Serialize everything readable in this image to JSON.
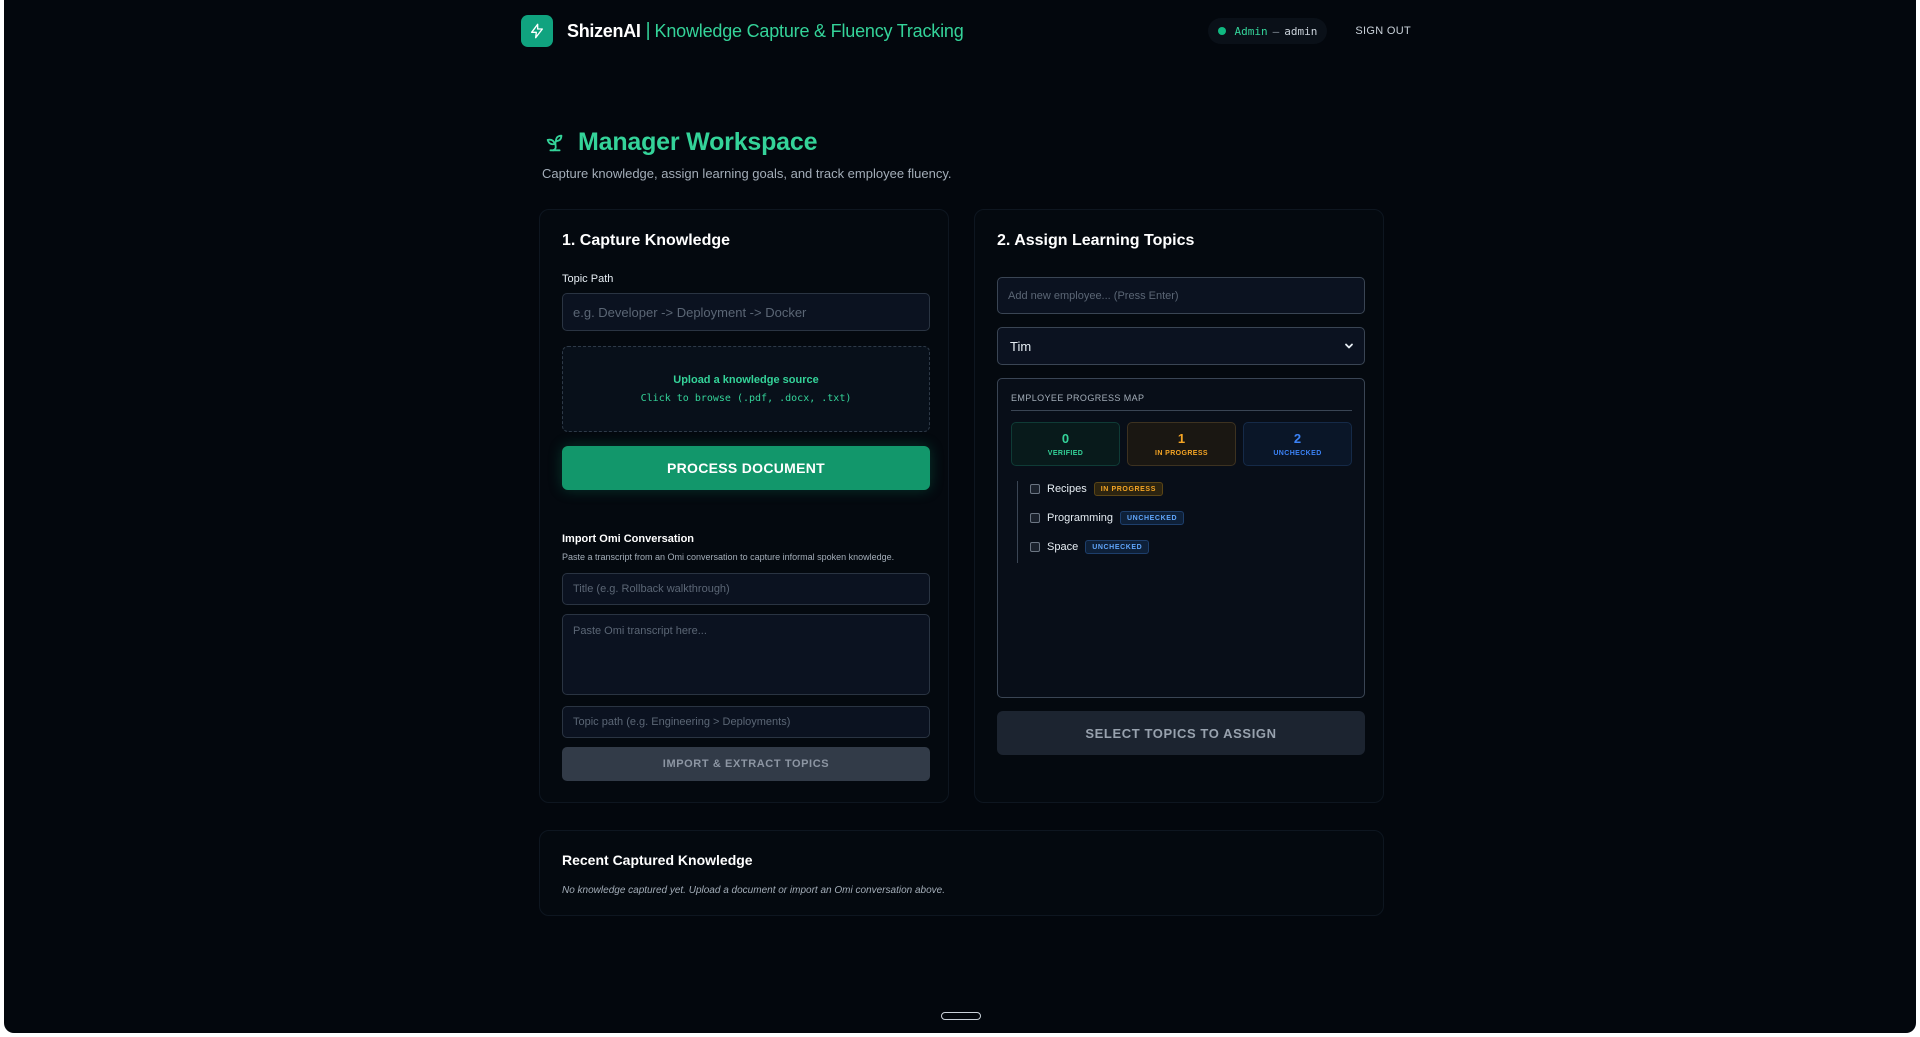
{
  "header": {
    "brand": "ShizenAI",
    "separator": "|",
    "subtitle": "Knowledge Capture & Fluency Tracking",
    "user_role": "Admin",
    "user_separator": "—",
    "user_name": "admin",
    "signout": "SIGN OUT"
  },
  "page": {
    "title": "Manager Workspace",
    "subtitle": "Capture knowledge, assign learning goals, and track employee fluency."
  },
  "capture": {
    "title": "1. Capture Knowledge",
    "topic_path_label": "Topic Path",
    "topic_path_placeholder": "e.g. Developer -> Deployment -> Docker",
    "upload_title": "Upload a knowledge source",
    "upload_hint": "Click to browse (.pdf, .docx, .txt)",
    "process_button": "PROCESS DOCUMENT",
    "omi_title": "Import Omi Conversation",
    "omi_description": "Paste a transcript from an Omi conversation to capture informal spoken knowledge.",
    "omi_title_placeholder": "Title (e.g. Rollback walkthrough)",
    "omi_transcript_placeholder": "Paste Omi transcript here...",
    "omi_topic_placeholder": "Topic path (e.g. Engineering > Deployments)",
    "import_button": "IMPORT & EXTRACT TOPICS"
  },
  "assign": {
    "title": "2. Assign Learning Topics",
    "new_employee_placeholder": "Add new employee... (Press Enter)",
    "selected_employee": "Tim",
    "progress_map_title": "EMPLOYEE PROGRESS MAP",
    "stats": {
      "verified": {
        "count": "0",
        "label": "VERIFIED"
      },
      "in_progress": {
        "count": "1",
        "label": "IN PROGRESS"
      },
      "unchecked": {
        "count": "2",
        "label": "UNCHECKED"
      }
    },
    "topics": [
      {
        "name": "Recipes",
        "status": "IN PROGRESS"
      },
      {
        "name": "Programming",
        "status": "UNCHECKED"
      },
      {
        "name": "Space",
        "status": "UNCHECKED"
      }
    ],
    "assign_button": "SELECT TOPICS TO ASSIGN"
  },
  "recent": {
    "title": "Recent Captured Knowledge",
    "empty": "No knowledge captured yet. Upload a document or import an Omi conversation above."
  },
  "colors": {
    "accent": "#34d399",
    "primary_button": "#12976b",
    "in_progress": "#f5a524",
    "unchecked": "#3b82f6",
    "background": "#03070d"
  }
}
